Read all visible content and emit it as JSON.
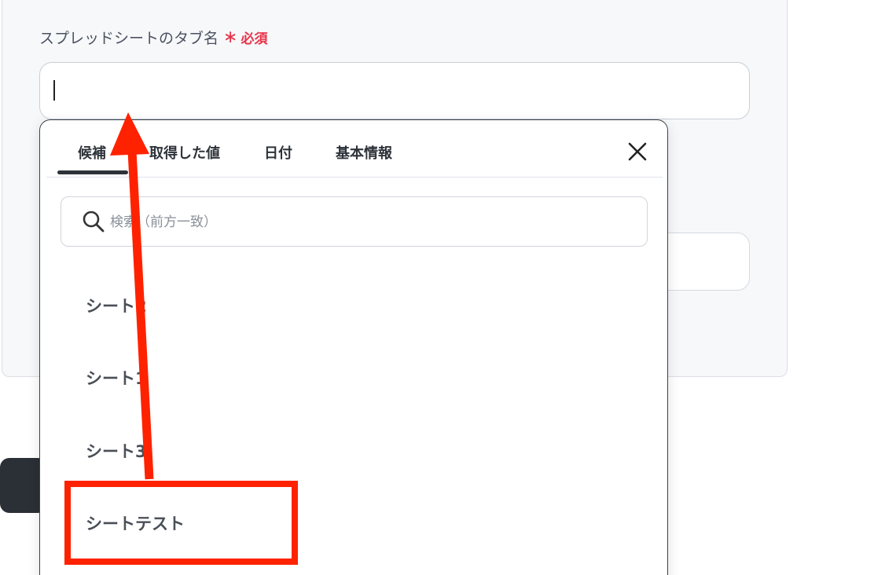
{
  "form": {
    "field_label": "スプレッドシートのタブ名",
    "required_star": "∗",
    "required_text": "必須",
    "tab_name_value": ""
  },
  "dropdown": {
    "tabs": [
      {
        "label": "候補"
      },
      {
        "label": "取得した値"
      },
      {
        "label": "日付"
      },
      {
        "label": "基本情報"
      }
    ],
    "active_tab": "候補",
    "search_placeholder": "検索（前方一致）",
    "options": [
      {
        "label": "シート2"
      },
      {
        "label": "シート1"
      },
      {
        "label": "シート3"
      },
      {
        "label": "シートテスト"
      }
    ]
  },
  "annotation": {
    "color": "#ff2200"
  },
  "icons": {
    "close": "close-icon",
    "search": "search-icon"
  }
}
